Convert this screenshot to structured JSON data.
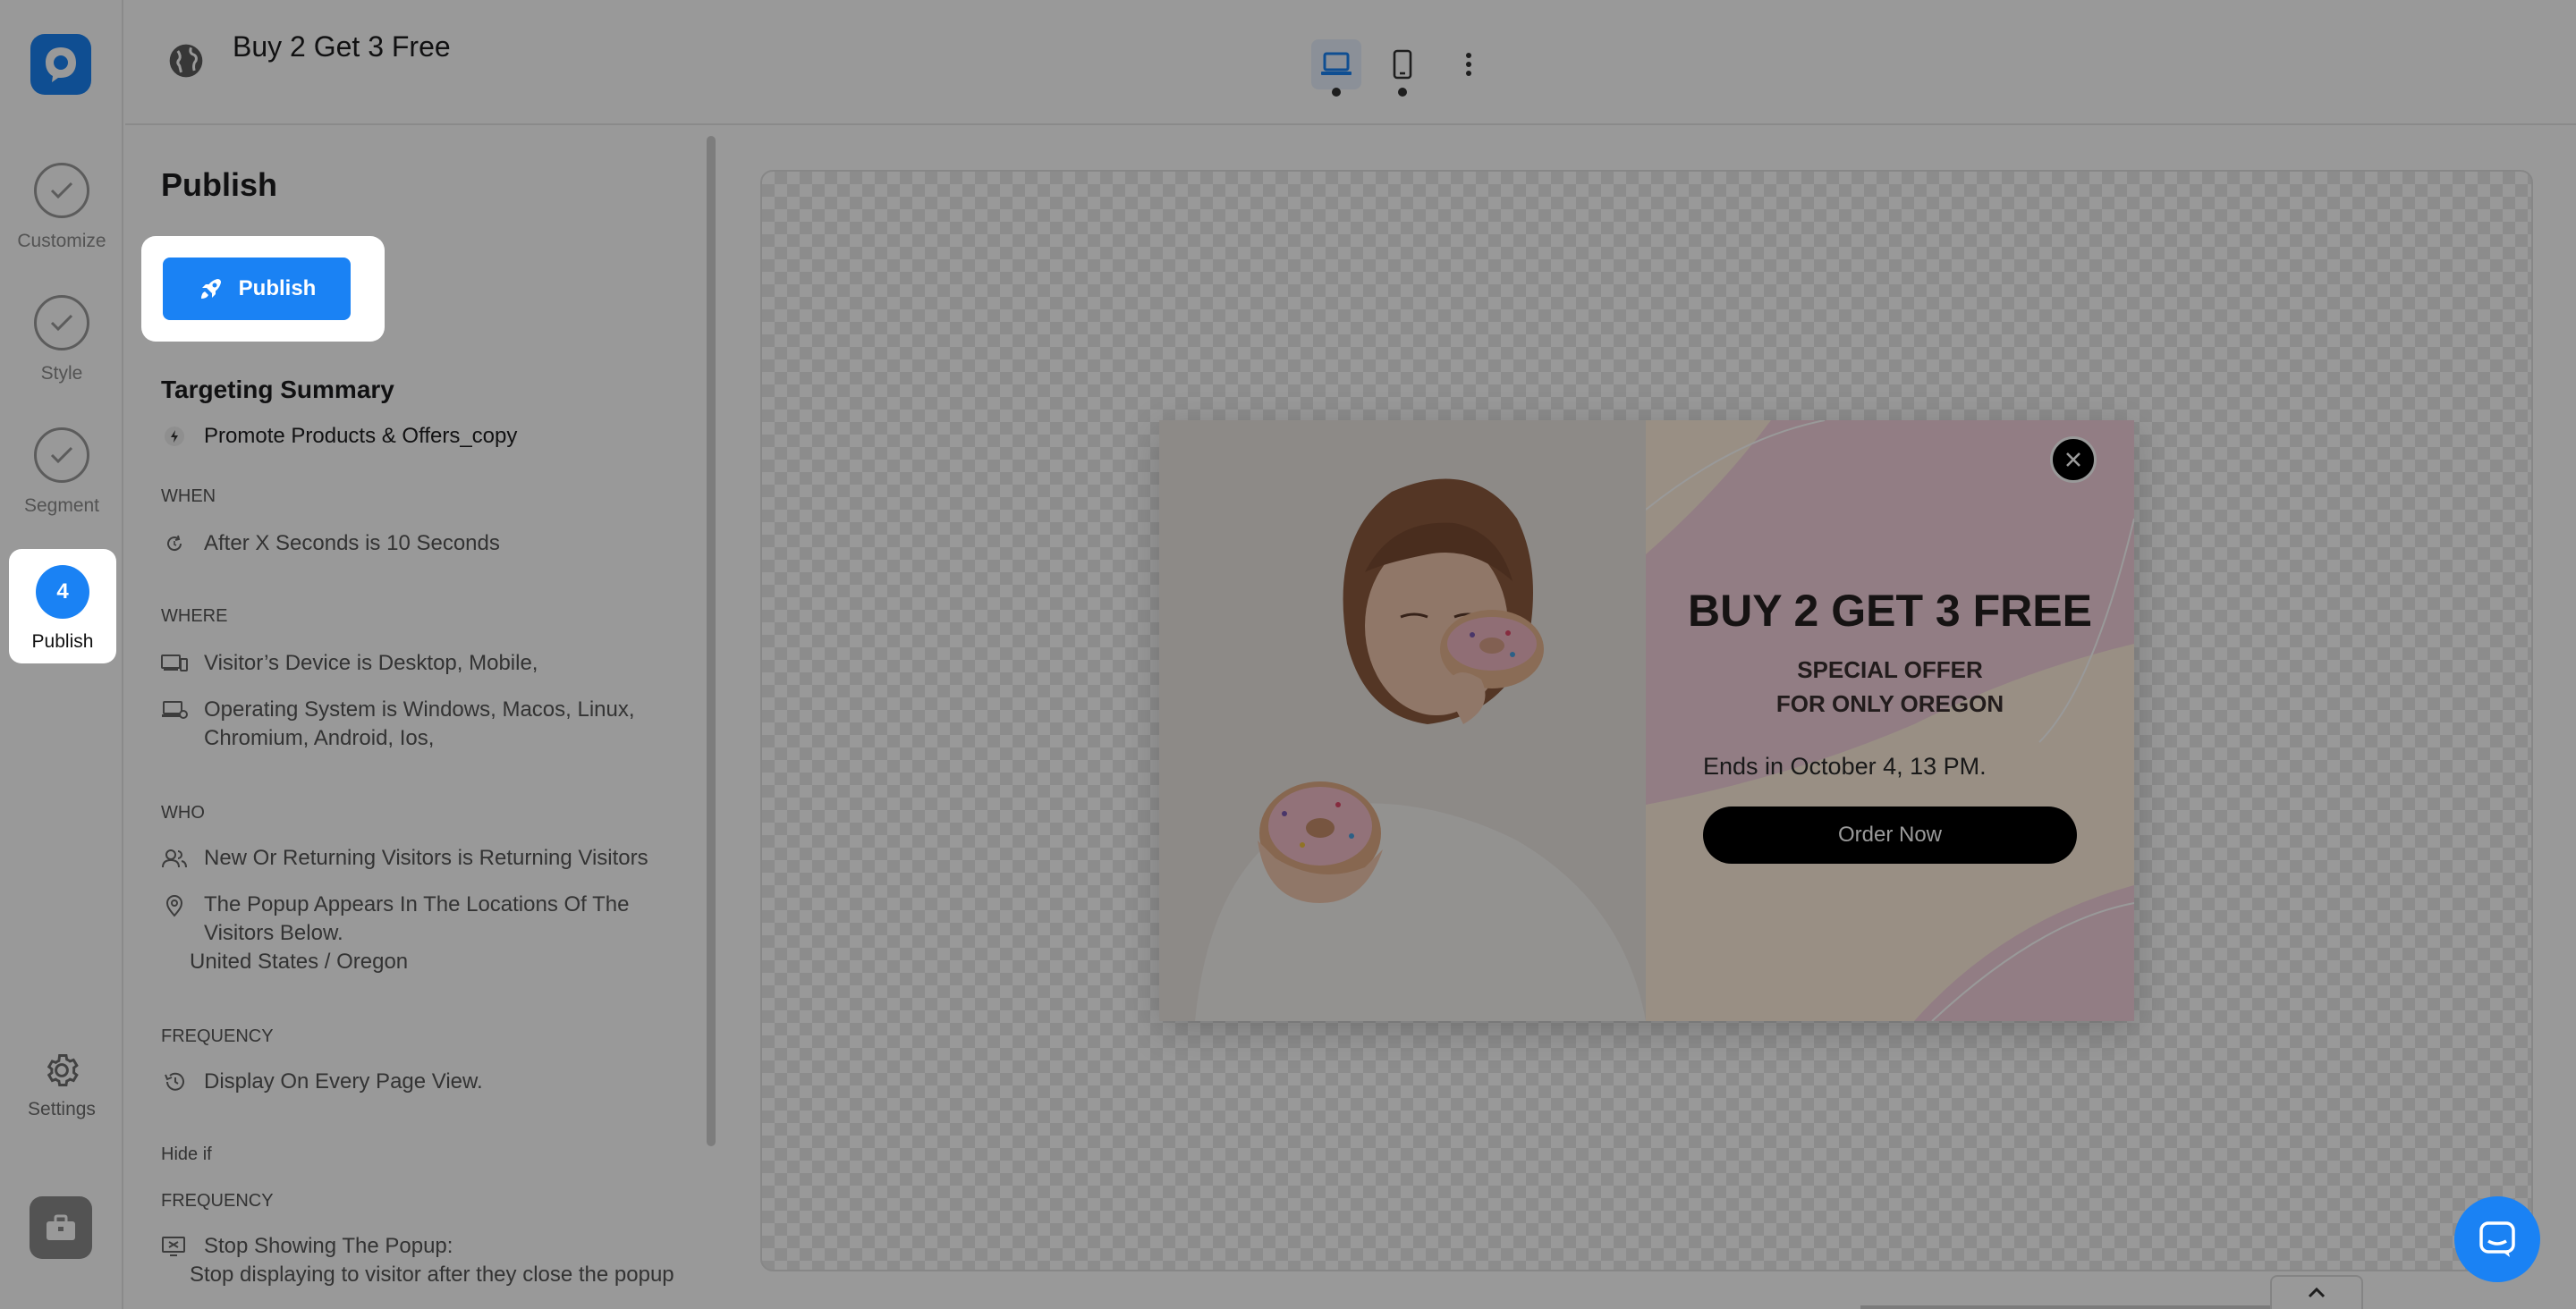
{
  "header": {
    "title": "Buy 2 Get 3 Free",
    "globe_icon": "globe-icon",
    "devices": [
      {
        "name": "desktop",
        "icon": "laptop-icon",
        "active": true
      },
      {
        "name": "mobile",
        "icon": "mobile-icon",
        "active": false
      }
    ],
    "more_icon": "more-vertical-icon"
  },
  "rail": {
    "items": [
      {
        "label": "Customize",
        "icon": "check-icon"
      },
      {
        "label": "Style",
        "icon": "check-icon"
      },
      {
        "label": "Segment",
        "icon": "check-icon"
      },
      {
        "label": "Publish",
        "step": "4"
      }
    ],
    "settings_label": "Settings"
  },
  "panel": {
    "heading": "Publish",
    "publish_button": "Publish",
    "targeting_title": "Targeting Summary",
    "campaign": "Promote Products & Offers_copy",
    "when_label": "WHEN",
    "when_rule": "After X Seconds is 10 Seconds",
    "where_label": "WHERE",
    "where_device": "Visitor’s Device is Desktop, Mobile,",
    "where_os": "Operating System is Windows, Macos, Linux, Chromium, Android, Ios,",
    "who_label": "WHO",
    "who_visitors": "New Or Returning Visitors is Returning Visitors",
    "who_location": "The Popup Appears In The Locations Of The Visitors Below.",
    "who_location_value": "United States / Oregon",
    "frequency_label": "FREQUENCY",
    "frequency_rule": "Display On Every Page View.",
    "hide_if_label": "Hide if",
    "hide_frequency_label": "FREQUENCY",
    "stop_title": "Stop Showing The Popup:",
    "stop_detail": "Stop displaying to visitor after they close the popup"
  },
  "popup": {
    "title": "BUY 2 GET 3 FREE",
    "subtitle_line1": "SPECIAL OFFER",
    "subtitle_line2": "FOR ONLY OREGON",
    "ends": "Ends in October 4, 13 PM.",
    "cta": "Order Now"
  },
  "colors": {
    "accent": "#1a82f4",
    "offer_bg": "#ffeedd",
    "offer_swoosh": "#f3d1dc",
    "cta_bg": "#000000"
  }
}
